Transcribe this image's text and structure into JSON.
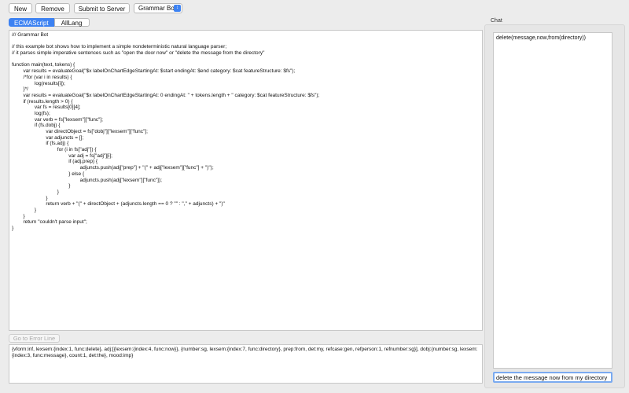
{
  "toolbar": {
    "new_label": "New",
    "remove_label": "Remove",
    "submit_label": "Submit to Server",
    "bot_select_value": "Grammar Bot"
  },
  "tabs": [
    {
      "label": "ECMAScript",
      "active": true
    },
    {
      "label": "AllLang",
      "active": false
    }
  ],
  "editor": {
    "lines": [
      "/// Grammar Bot",
      "",
      "// this example bot shows how to implement a simple nondeterministic natural language parser;",
      "// it parses simple imperative sentences such as \"open the door now\" or \"delete the message from the directory\"",
      "",
      "function main(text, tokens) {",
      "        var results = evaluateGoal(\"$x labelOnChartEdgeStartingAt: $start endingAt: $end category: $cat featureStructure: $fs\");",
      "        /*for (var i in results) {",
      "                log(results[i]);",
      "        }*/",
      "        var results = evaluateGoal(\"$x labelOnChartEdgeStartingAt: 0 endingAt: \" + tokens.length + \" category: $cat featureStructure: $fs\");",
      "        if (results.length > 0) {",
      "                var fs = results[0][4];",
      "                log(fs);",
      "                var verb = fs[\"lexsem\"][\"func\"];",
      "                if (fs.dobj) {",
      "                        var directObject = fs[\"dobj\"][\"lexsem\"][\"func\"];",
      "                        var adjuncts = [];",
      "                        if (fs.adj) {",
      "                                for (i in fs[\"adj\"]) {",
      "                                        var adj = fs[\"adj\"][i];",
      "                                        if (adj.prep) {",
      "                                                adjuncts.push(adj[\"prep\"] + \"(\" + adj[\"lexsem\"][\"func\"] + \")\");",
      "                                        } else {",
      "                                                adjuncts.push(adj[\"lexsem\"][\"func\"]);",
      "                                        }",
      "                                }",
      "                        }",
      "                        return verb + \"(\" + directObject + (adjuncts.length == 0 ? \"\" : \",\" + adjuncts) + \")\"",
      "                }",
      "        }",
      "        return \"couldn't parse input\";",
      "}"
    ]
  },
  "error_button_label": "Go to Error Line",
  "output_text": "{vform:inf, lexsem:{index:1, func:delete}, adj:[{lexsem:{index:4, func:now}}, {number:sg, lexsem:{index:7, func:directory}, prep:from, det:my, refcase:gen, refperson:1, refnumber:sg}], dobj:{number:sg, lexsem:{index:3, func:message}, count:1, det:the}, mood:imp}",
  "chat": {
    "label": "Chat",
    "log": "delete(message,now,from(directory))",
    "input_value": "delete the message now from my directory"
  },
  "colors": {
    "accent": "#3d82f2",
    "background": "#ececec"
  }
}
